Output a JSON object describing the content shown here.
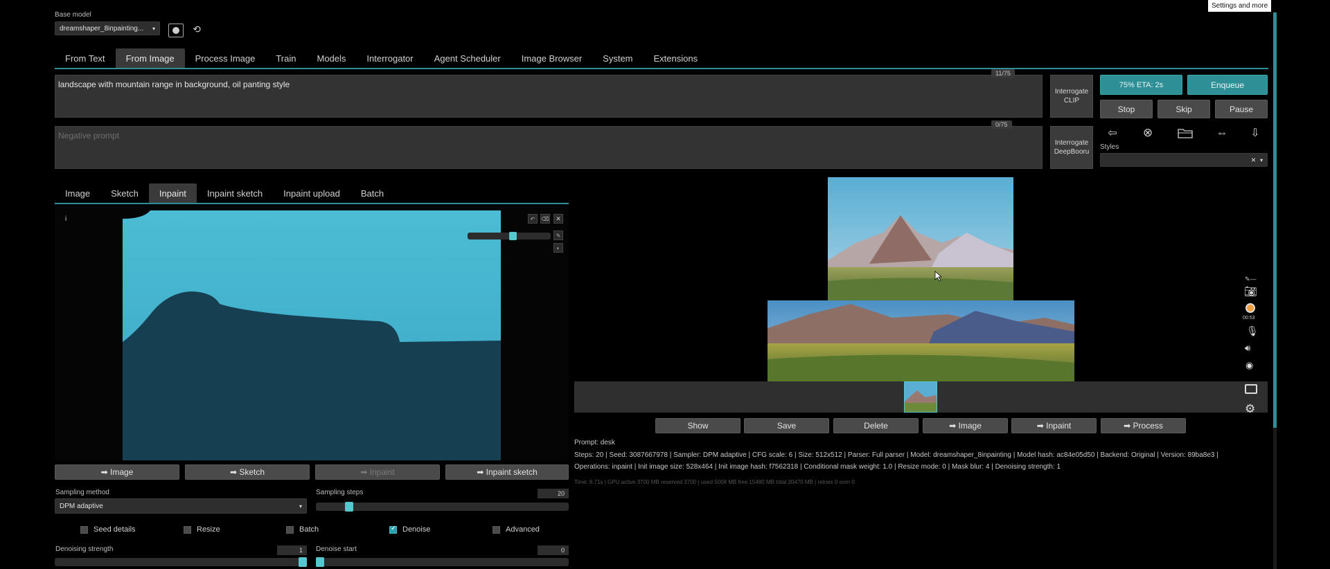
{
  "tooltip": "Settings and more",
  "base_model": {
    "label": "Base model",
    "value": "dreamshaper_8inpainting..."
  },
  "main_tabs": [
    "From Text",
    "From Image",
    "Process Image",
    "Train",
    "Models",
    "Interrogator",
    "Agent Scheduler",
    "Image Browser",
    "System",
    "Extensions"
  ],
  "prompt": {
    "value": "landscape with mountain range in background, oil panting style",
    "counter": "11/75"
  },
  "negative_prompt": {
    "placeholder": "Negative prompt",
    "counter": "0/75"
  },
  "interrogate": {
    "clip": "Interrogate CLIP",
    "deepbooru": "Interrogate DeepBooru"
  },
  "progress": {
    "label": "75% ETA: 2s",
    "value": 0.75
  },
  "actions": {
    "enqueue": "Enqueue",
    "stop": "Stop",
    "skip": "Skip",
    "pause": "Pause"
  },
  "styles": {
    "label": "Styles",
    "clear": "×"
  },
  "image_tabs": [
    "Image",
    "Sketch",
    "Inpaint",
    "Inpaint sketch",
    "Inpaint upload",
    "Batch"
  ],
  "canvas": {
    "info_marker": "i",
    "brush_size": 0.55
  },
  "send_buttons": [
    "➡ Image",
    "➡ Sketch",
    "➡ Inpaint",
    "➡ Inpaint sketch"
  ],
  "sampling": {
    "method_label": "Sampling method",
    "method_value": "DPM adaptive",
    "steps_label": "Sampling steps",
    "steps_value": "20",
    "steps_fraction": 0.12
  },
  "options": [
    {
      "label": "Seed details",
      "checked": false
    },
    {
      "label": "Resize",
      "checked": false
    },
    {
      "label": "Batch",
      "checked": false
    },
    {
      "label": "Denoise",
      "checked": true
    },
    {
      "label": "Advanced",
      "checked": false
    }
  ],
  "denoise": {
    "strength_label": "Denoising strength",
    "strength_value": "1",
    "start_label": "Denoise start",
    "start_value": "0"
  },
  "gallery_buttons": [
    "Show",
    "Save",
    "Delete",
    "➡ Image",
    "➡ Inpaint",
    "➡ Process"
  ],
  "output_info": {
    "prompt_line": "Prompt: desk",
    "line1": "Steps: 20 | Seed: 3087667978 | Sampler: DPM adaptive | CFG scale: 6 | Size: 512x512 | Parser: Full parser | Model: dreamshaper_8inpainting | Model hash: ac84e05d50 | Backend: Original | Version: 89ba8e3 |",
    "line2": "Operations: inpaint | Init image size: 528x464 | Init image hash: f7562318 | Conditional mask weight: 1.0 | Resize mode: 0 | Mask blur: 4 | Denoising strength: 1",
    "line3": "Time: 8.71s | GPU active 3700 MB reserved 3700 | used 5008 MB free 15480 MB total 20470 MB | retries 0 oom 0"
  },
  "recorder": {
    "time": "00:53"
  },
  "colors": {
    "accent": "#2f8f96",
    "slider": "#57c7cf",
    "canvas_sky": "#4ab5cf",
    "canvas_mask": "#173f52"
  }
}
